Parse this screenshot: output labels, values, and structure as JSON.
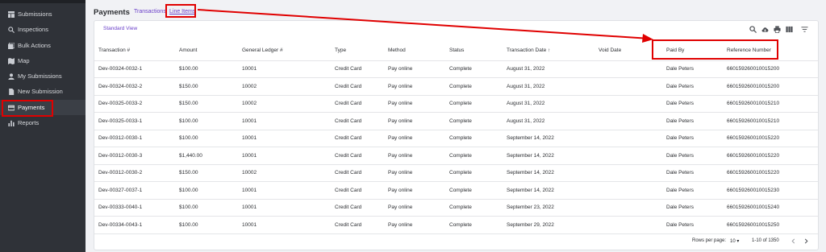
{
  "sidebar": {
    "items": [
      {
        "label": "Submissions",
        "icon": "grid-icon"
      },
      {
        "label": "Inspections",
        "icon": "search-icon"
      },
      {
        "label": "Bulk Actions",
        "icon": "layers-icon"
      },
      {
        "label": "Map",
        "icon": "map-icon"
      },
      {
        "label": "My Submissions",
        "icon": "person-icon"
      },
      {
        "label": "New Submission",
        "icon": "document-icon"
      },
      {
        "label": "Payments",
        "icon": "card-icon"
      },
      {
        "label": "Reports",
        "icon": "bar-chart-icon"
      }
    ]
  },
  "header": {
    "title": "Payments",
    "tabs": [
      "Transactions",
      "Line Items"
    ],
    "active_tab": "Line Items"
  },
  "toolbar": {
    "view_label": "Standard View",
    "icons": [
      "search-icon",
      "cloud-download-icon",
      "print-icon",
      "columns-icon",
      "filter-icon"
    ]
  },
  "table": {
    "columns": [
      "Transaction #",
      "Amount",
      "General Ledger #",
      "Type",
      "Method",
      "Status",
      "Transaction Date",
      "Void Date",
      "Paid By",
      "Reference Number"
    ],
    "sort_indicator": "↑",
    "rows": [
      [
        "Dev-00324-0032-1",
        "$100.00",
        "10001",
        "Credit Card",
        "Pay online",
        "Complete",
        "August 31, 2022",
        "",
        "Dale Peters",
        "660159260010015200"
      ],
      [
        "Dev-00324-0032-2",
        "$150.00",
        "10002",
        "Credit Card",
        "Pay online",
        "Complete",
        "August 31, 2022",
        "",
        "Dale Peters",
        "660159260010015200"
      ],
      [
        "Dev-00325-0033-2",
        "$150.00",
        "10002",
        "Credit Card",
        "Pay online",
        "Complete",
        "August 31, 2022",
        "",
        "Dale Peters",
        "660159260010015210"
      ],
      [
        "Dev-00325-0033-1",
        "$100.00",
        "10001",
        "Credit Card",
        "Pay online",
        "Complete",
        "August 31, 2022",
        "",
        "Dale Peters",
        "660159260010015210"
      ],
      [
        "Dev-00312-0030-1",
        "$100.00",
        "10001",
        "Credit Card",
        "Pay online",
        "Complete",
        "September 14, 2022",
        "",
        "Dale Peters",
        "660159260010015220"
      ],
      [
        "Dev-00312-0030-3",
        "$1,440.00",
        "10001",
        "Credit Card",
        "Pay online",
        "Complete",
        "September 14, 2022",
        "",
        "Dale Peters",
        "660159260010015220"
      ],
      [
        "Dev-00312-0030-2",
        "$150.00",
        "10002",
        "Credit Card",
        "Pay online",
        "Complete",
        "September 14, 2022",
        "",
        "Dale Peters",
        "660159260010015220"
      ],
      [
        "Dev-00327-0037-1",
        "$100.00",
        "10001",
        "Credit Card",
        "Pay online",
        "Complete",
        "September 14, 2022",
        "",
        "Dale Peters",
        "660159260010015230"
      ],
      [
        "Dev-00333-0040-1",
        "$100.00",
        "10001",
        "Credit Card",
        "Pay online",
        "Complete",
        "September 23, 2022",
        "",
        "Dale Peters",
        "660159260010015240"
      ],
      [
        "Dev-00334-0043-1",
        "$100.00",
        "10001",
        "Credit Card",
        "Pay online",
        "Complete",
        "September 29, 2022",
        "",
        "Dale Peters",
        "660159260010015250"
      ]
    ]
  },
  "pagination": {
    "rows_per_page_label": "Rows per page:",
    "rows_per_page_value": "10",
    "range_label": "1-10 of 1350"
  },
  "colors": {
    "sidebar_bg": "#2f3238",
    "accent": "#6a3fc9",
    "annotation": "#e00000"
  }
}
